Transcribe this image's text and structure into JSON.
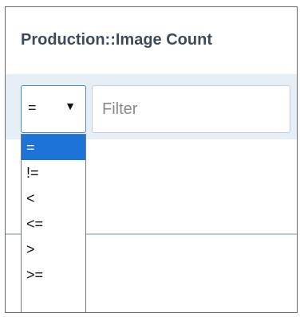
{
  "header": {
    "title": "Production::Image Count"
  },
  "filter": {
    "operator_value": "=",
    "arrow_glyph": "▼",
    "placeholder": "Filter"
  },
  "dropdown": {
    "options": [
      "=",
      "!=",
      "<",
      "<=",
      ">",
      ">="
    ],
    "selected": "="
  },
  "colors": {
    "accent": "#1e73d8",
    "filter_bar_bg": "#e6eef6",
    "title": "#3e4a5b"
  }
}
